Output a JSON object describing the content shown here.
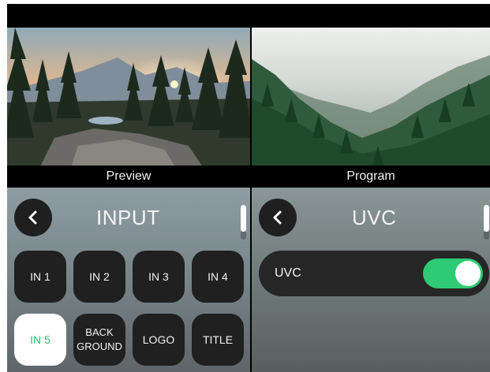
{
  "monitors": {
    "preview_label": "Preview",
    "program_label": "Program"
  },
  "input_panel": {
    "title": "INPUT",
    "back_icon": "chevron-left-icon",
    "buttons": [
      {
        "label": "IN 1",
        "active": false
      },
      {
        "label": "IN 2",
        "active": false
      },
      {
        "label": "IN 3",
        "active": false
      },
      {
        "label": "IN 4",
        "active": false
      },
      {
        "label": "IN 5",
        "active": true
      },
      {
        "label": "BACK\nGROUND",
        "active": false
      },
      {
        "label": "LOGO",
        "active": false
      },
      {
        "label": "TITLE",
        "active": false
      }
    ]
  },
  "uvc_panel": {
    "title": "UVC",
    "back_icon": "chevron-left-icon",
    "toggle_label": "UVC",
    "toggle_on": true
  },
  "colors": {
    "accent_green": "#2fcb74",
    "button_dark": "#202020",
    "active_text": "#2fc46e"
  }
}
